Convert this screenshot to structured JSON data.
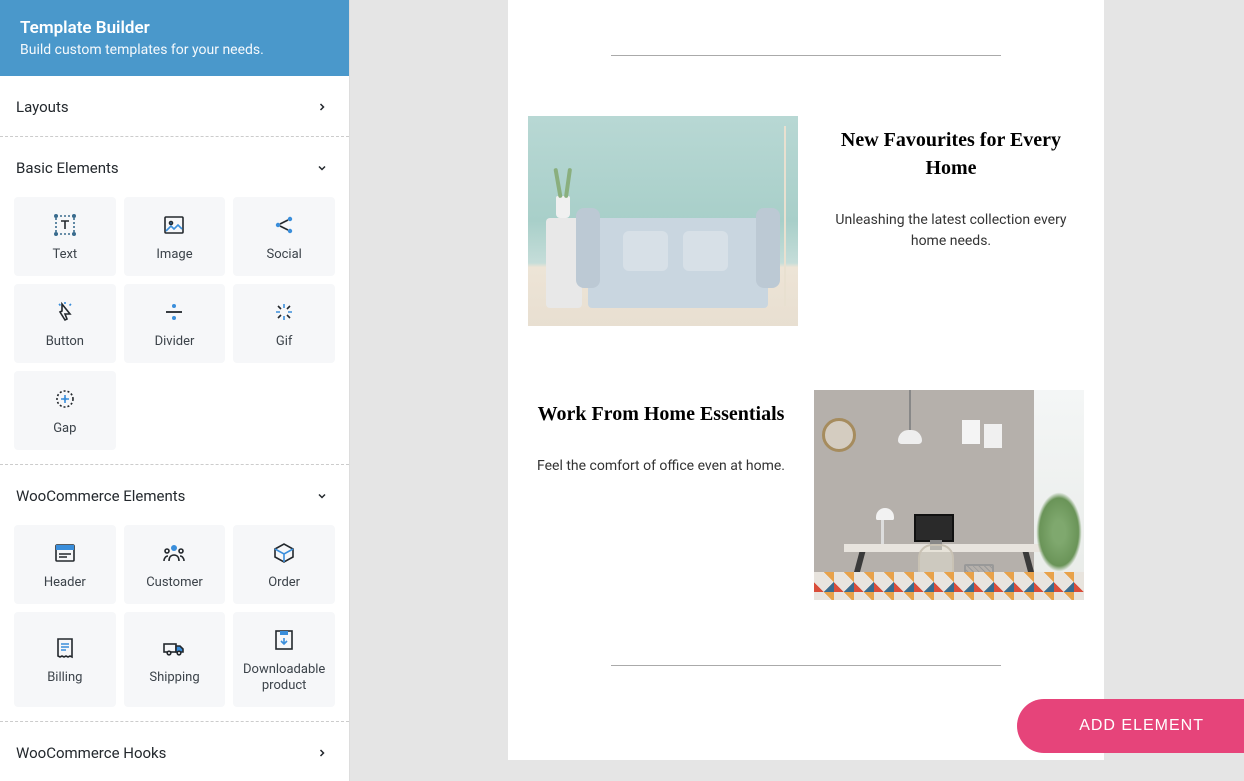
{
  "sidebar": {
    "header": {
      "title": "Template Builder",
      "subtitle": "Build custom templates for your needs."
    },
    "sections": {
      "layouts": {
        "title": "Layouts"
      },
      "basic": {
        "title": "Basic Elements",
        "items": [
          {
            "label": "Text",
            "icon": "text-icon"
          },
          {
            "label": "Image",
            "icon": "image-icon"
          },
          {
            "label": "Social",
            "icon": "social-icon"
          },
          {
            "label": "Button",
            "icon": "button-icon"
          },
          {
            "label": "Divider",
            "icon": "divider-icon"
          },
          {
            "label": "Gif",
            "icon": "gif-icon"
          },
          {
            "label": "Gap",
            "icon": "gap-icon"
          }
        ]
      },
      "woo": {
        "title": "WooCommerce Elements",
        "items": [
          {
            "label": "Header",
            "icon": "header-icon"
          },
          {
            "label": "Customer",
            "icon": "customer-icon"
          },
          {
            "label": "Order",
            "icon": "order-icon"
          },
          {
            "label": "Billing",
            "icon": "billing-icon"
          },
          {
            "label": "Shipping",
            "icon": "shipping-icon"
          },
          {
            "label": "Downloadable product",
            "icon": "download-product-icon"
          }
        ]
      },
      "hooks": {
        "title": "WooCommerce Hooks"
      }
    }
  },
  "canvas": {
    "blocks": [
      {
        "heading": "New Favourites for Every Home",
        "desc": "Unleashing the latest collection every home needs."
      },
      {
        "heading": "Work From Home Essentials",
        "desc": "Feel the comfort of office even at home."
      }
    ],
    "add_element_label": "ADD ELEMENT"
  }
}
